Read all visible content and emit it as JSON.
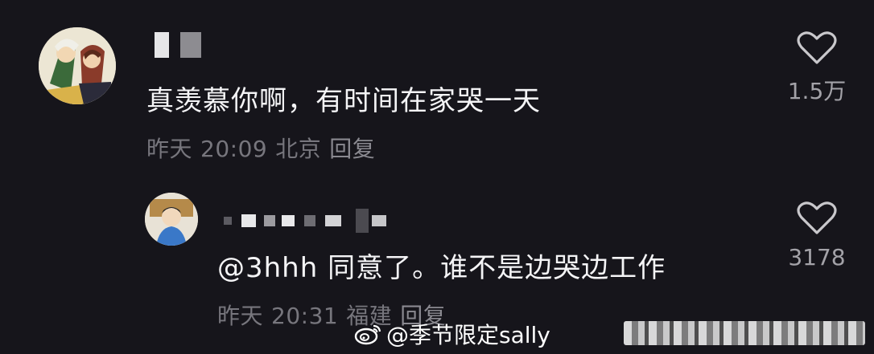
{
  "comments": [
    {
      "text": "真羡慕你啊，有时间在家哭一天",
      "date": "昨天",
      "time": "20:09",
      "location": "北京",
      "reply_label": "回复",
      "like_count": "1.5万"
    },
    {
      "text": "@3hhh 同意了。谁不是边哭边工作",
      "date": "昨天",
      "time": "20:31",
      "location": "福建",
      "reply_label": "回复",
      "like_count": "3178"
    }
  ],
  "watermark": {
    "text": "@季节限定sally",
    "icon": "weibo-icon"
  },
  "icons": {
    "like": "heart-outline-icon"
  }
}
